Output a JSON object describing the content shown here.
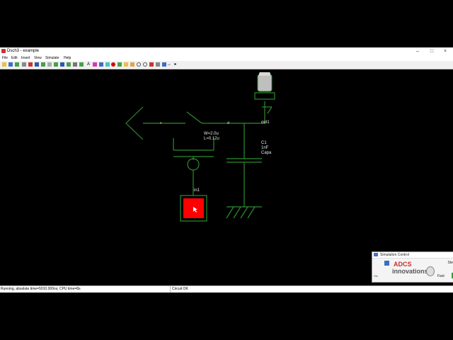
{
  "window": {
    "title": "Dsch3 - example",
    "controls": {
      "minimize": "–",
      "maximize": "□",
      "close": "×"
    }
  },
  "menu": [
    "File",
    "Edit",
    "Insert",
    "View",
    "Simulate",
    "Help"
  ],
  "schematic": {
    "label_s": "s",
    "label_d": "d",
    "label_out": "out1",
    "label_in": "in1",
    "transistor_w": "W=2.0u",
    "transistor_l": "L=0.12u",
    "cap_name": "C1",
    "cap_value": "1nF",
    "cap_type": "Capa"
  },
  "status": {
    "left": "Running, absolute time=5010.000ns; CPU time=8s",
    "right": "Circuit OK"
  },
  "sim_control": {
    "title": "Simulation Control",
    "step": "Ste",
    "step_btn": "Ste",
    "fast": "Fast"
  },
  "watermark": {
    "brand": "ADCS",
    "tagline": "innovations"
  },
  "colors": {
    "wire": "#2e8b2e",
    "input_button": "#ff0000",
    "background": "#000000"
  }
}
